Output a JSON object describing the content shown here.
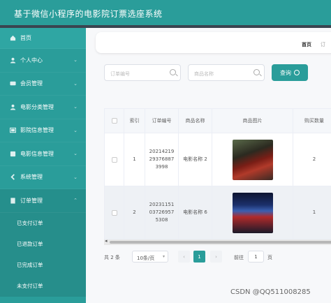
{
  "app": {
    "title": "基于微信小程序的电影院订票选座系统"
  },
  "sidebar": {
    "items": [
      {
        "label": "首页",
        "icon": "home-icon"
      },
      {
        "label": "个人中心",
        "icon": "user-icon"
      },
      {
        "label": "会员管理",
        "icon": "card-icon"
      },
      {
        "label": "电影分类管理",
        "icon": "user-icon"
      },
      {
        "label": "影院信息管理",
        "icon": "cinema-icon"
      },
      {
        "label": "电影信息管理",
        "icon": "film-icon"
      },
      {
        "label": "系统管理",
        "icon": "chevron-left-icon"
      },
      {
        "label": "订单管理",
        "icon": "order-icon"
      }
    ],
    "subitems": [
      "已支付订单",
      "已退款订单",
      "已完成订单",
      "未支付订单"
    ]
  },
  "breadcrumb": {
    "home": "首页",
    "current": "订"
  },
  "search": {
    "order_placeholder": "订单编号",
    "name_placeholder": "商品名称",
    "button_label": "查询"
  },
  "table": {
    "headers": [
      "索引",
      "订单编号",
      "商品名称",
      "商品图片",
      "购买数量"
    ],
    "rows": [
      {
        "index": "1",
        "order_no": "20214219 29376887 3998",
        "name": "电影名称 2",
        "qty": "2"
      },
      {
        "index": "2",
        "order_no": "20231151 03726957 5308",
        "name": "电影名称 6",
        "qty": "1"
      }
    ]
  },
  "pager": {
    "total": "共 2 条",
    "page_size": "10条/页",
    "current": "1",
    "goto_prefix": "前往",
    "goto_value": "1",
    "goto_suffix": "页"
  },
  "watermark": "CSDN @QQ511008285"
}
